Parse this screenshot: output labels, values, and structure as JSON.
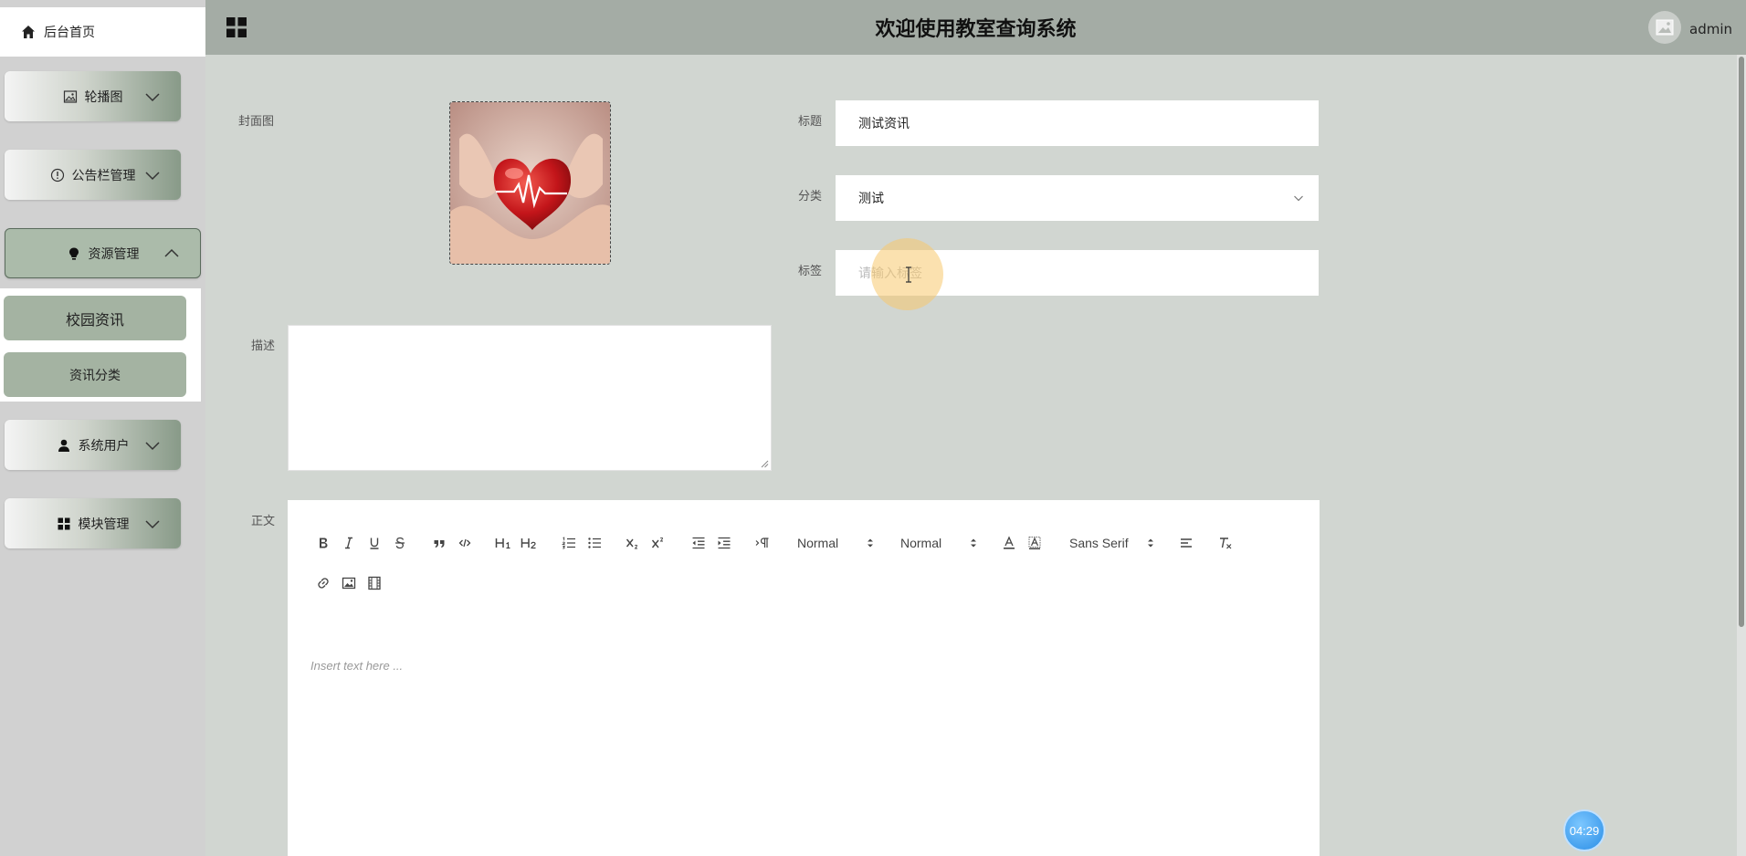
{
  "header": {
    "title": "欢迎使用教室查询系统",
    "username": "admin"
  },
  "sidebar": {
    "home_label": "后台首页",
    "menus": [
      {
        "label": "轮播图",
        "icon": "image-icon",
        "expanded": false
      },
      {
        "label": "公告栏管理",
        "icon": "info-circle-icon",
        "expanded": false
      },
      {
        "label": "资源管理",
        "icon": "lightbulb-icon",
        "expanded": true,
        "children": [
          {
            "label": "校园资讯"
          },
          {
            "label": "资讯分类"
          }
        ]
      },
      {
        "label": "系统用户",
        "icon": "user-icon",
        "expanded": false
      },
      {
        "label": "模块管理",
        "icon": "grid-icon",
        "expanded": false
      }
    ]
  },
  "form": {
    "cover_label": "封面图",
    "title_label": "标题",
    "title_value": "测试资讯",
    "category_label": "分类",
    "category_value": "测试",
    "tags_label": "标签",
    "tags_placeholder": "请输入标签",
    "desc_label": "描述",
    "desc_value": "",
    "body_label": "正文"
  },
  "editor": {
    "header_select": "Normal",
    "size_select": "Normal",
    "font_select": "Sans Serif",
    "placeholder": "Insert text here ..."
  },
  "timer": "04:29",
  "colors": {
    "header_bg": "#a4aca5",
    "content_bg": "#d1d6d1",
    "submenu_item": "#a4b3a2",
    "timer": "#2b8ee6"
  }
}
